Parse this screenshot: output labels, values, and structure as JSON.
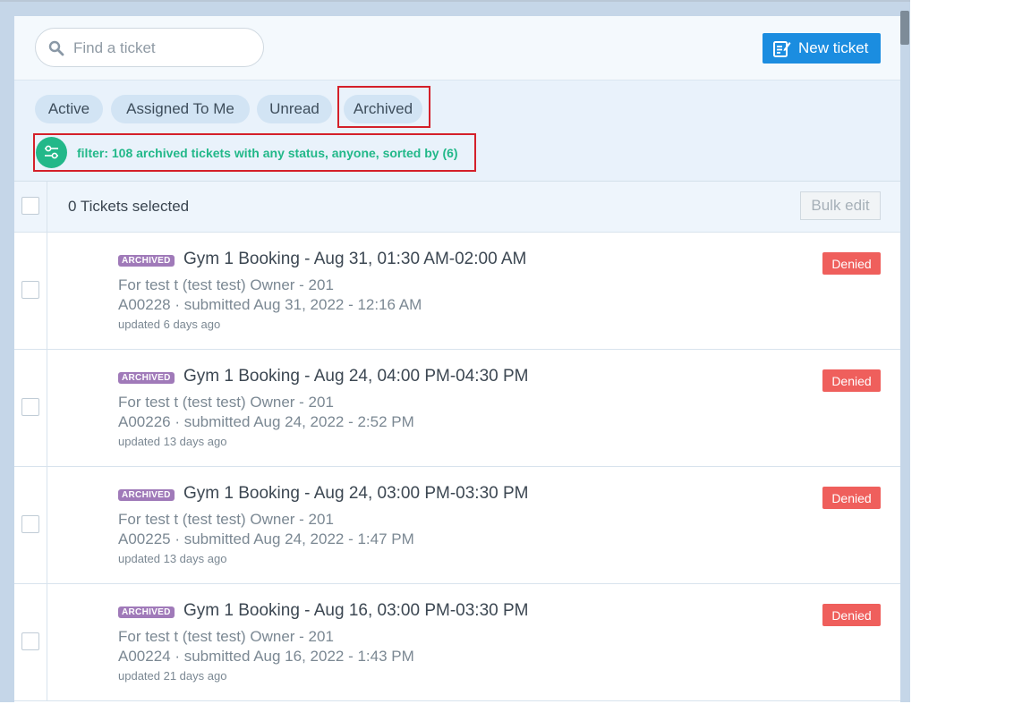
{
  "search": {
    "placeholder": "Find a ticket"
  },
  "new_ticket": {
    "label": "New ticket"
  },
  "tabs": [
    {
      "label": "Active"
    },
    {
      "label": "Assigned To Me"
    },
    {
      "label": "Unread"
    },
    {
      "label": "Archived"
    }
  ],
  "filter": {
    "text": "filter: 108 archived tickets with any status, anyone, sorted by (6)"
  },
  "selection": {
    "label": "0 Tickets selected",
    "bulk_edit": "Bulk edit"
  },
  "tickets": [
    {
      "badge": "ARCHIVED",
      "title": "Gym 1 Booking - Aug 31, 01:30 AM-02:00 AM",
      "for": "For test t (test test) Owner - 201",
      "submitted": "A00228 · submitted Aug 31, 2022 - 12:16 AM",
      "updated": "updated 6 days ago",
      "status": "Denied"
    },
    {
      "badge": "ARCHIVED",
      "title": "Gym 1 Booking - Aug 24, 04:00 PM-04:30 PM",
      "for": "For test t (test test) Owner - 201",
      "submitted": "A00226 · submitted Aug 24, 2022 - 2:52 PM",
      "updated": "updated 13 days ago",
      "status": "Denied"
    },
    {
      "badge": "ARCHIVED",
      "title": "Gym 1 Booking - Aug 24, 03:00 PM-03:30 PM",
      "for": "For test t (test test) Owner - 201",
      "submitted": "A00225 · submitted Aug 24, 2022 - 1:47 PM",
      "updated": "updated 13 days ago",
      "status": "Denied"
    },
    {
      "badge": "ARCHIVED",
      "title": "Gym 1 Booking - Aug 16, 03:00 PM-03:30 PM",
      "for": "For test t (test test) Owner - 201",
      "submitted": "A00224 · submitted Aug 16, 2022 - 1:43 PM",
      "updated": "updated 21 days ago",
      "status": "Denied"
    }
  ],
  "colors": {
    "accent": "#1b8de0",
    "filter_green": "#22b889",
    "denied_red": "#ef5f5c",
    "archived_purple": "#a07ab9",
    "highlight_red": "#d4202a"
  }
}
